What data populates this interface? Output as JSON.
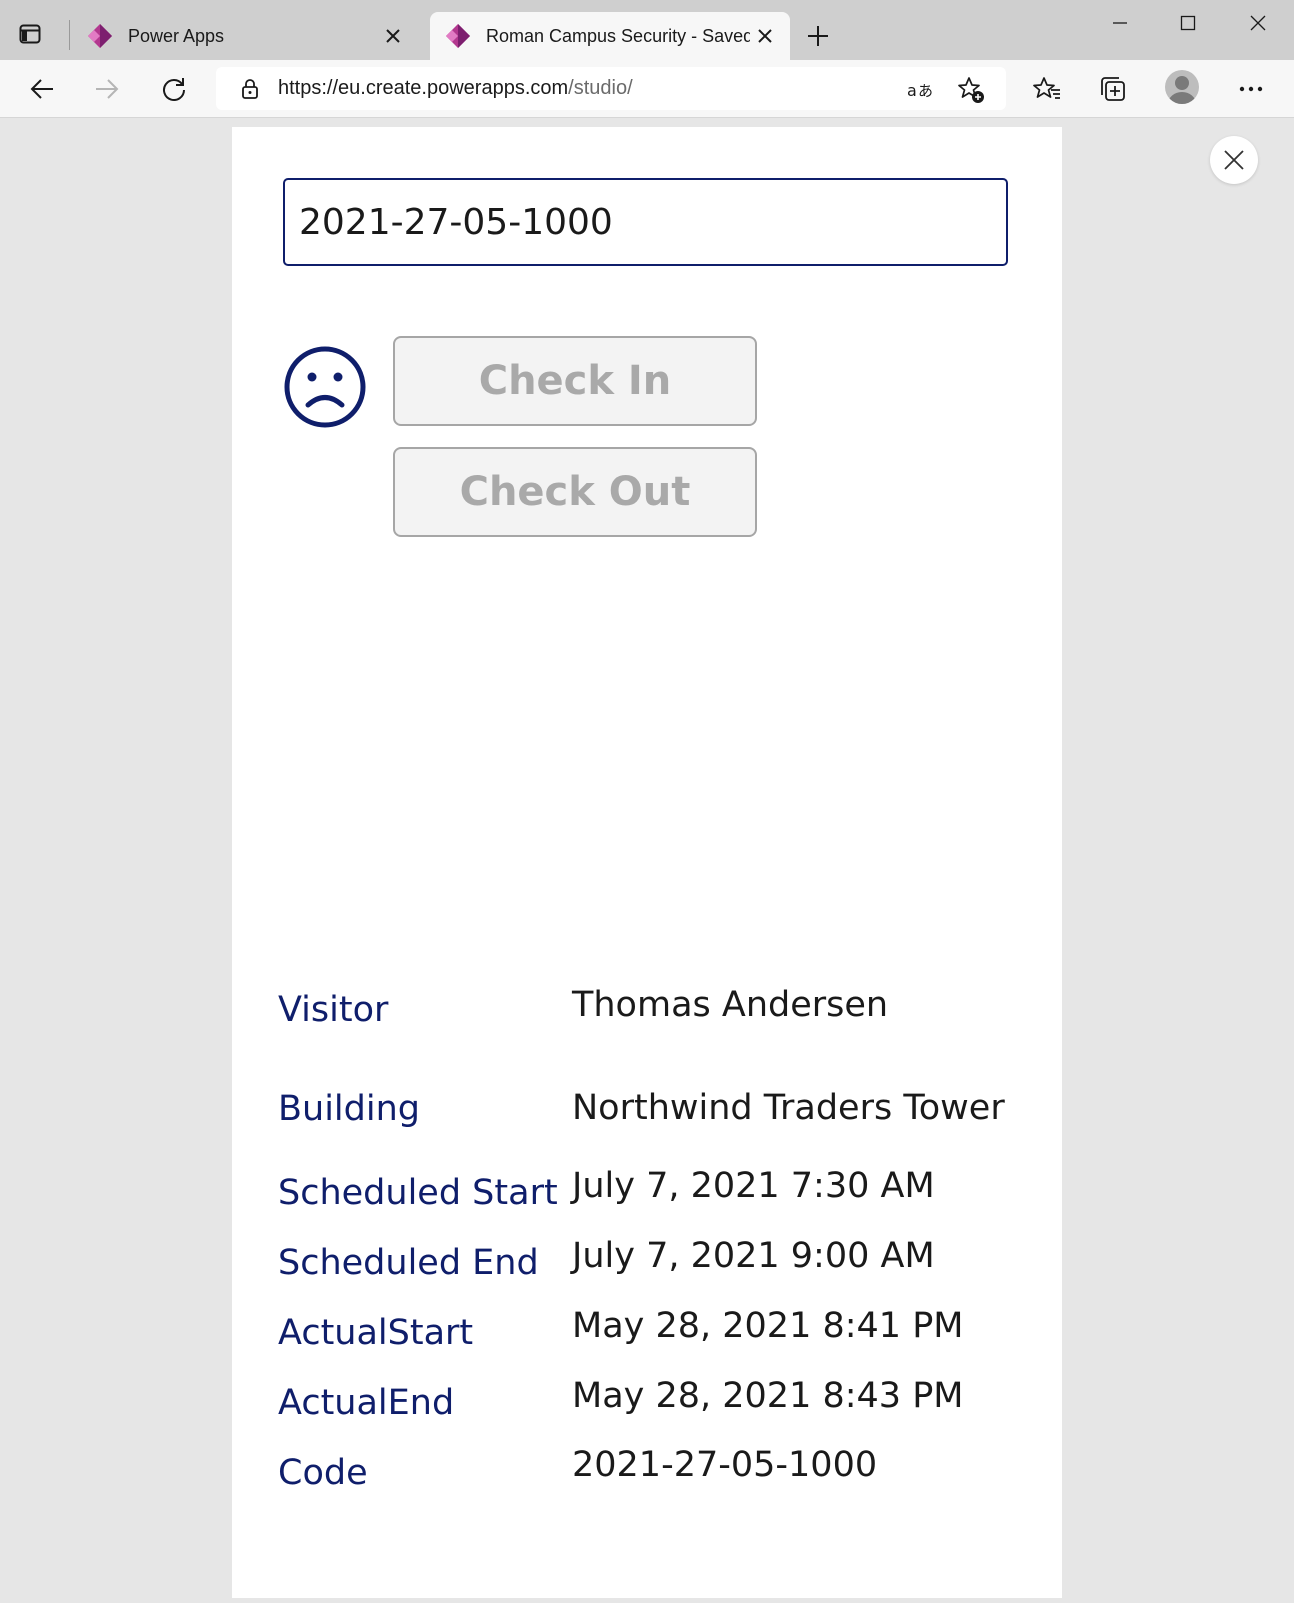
{
  "browser": {
    "tabs": [
      {
        "title": "Power Apps",
        "active": false,
        "icon": "power-apps-icon"
      },
      {
        "title": "Roman Campus Security - Saved",
        "active": true,
        "icon": "power-apps-icon"
      }
    ],
    "address": {
      "domain": "https://eu.create.powerapps.com",
      "path": "/studio/"
    },
    "icons": [
      "back-icon",
      "forward-icon",
      "refresh-icon",
      "lock-icon",
      "read-aloud-icon",
      "add-favorite-icon",
      "favorites-icon",
      "collections-icon",
      "profile-avatar",
      "more-icon",
      "tab-actions-icon",
      "new-tab-icon",
      "minimize-icon",
      "maximize-icon",
      "close-window-icon"
    ]
  },
  "app": {
    "code_input": {
      "value": "2021-27-05-1000"
    },
    "status_icon": "sad-face-icon",
    "check_in_label": "Check In",
    "check_out_label": "Check Out",
    "accent_color": "#0f1e6b",
    "fields": [
      {
        "label": "Visitor",
        "value": "Thomas Andersen"
      },
      {
        "label": "Building",
        "value": "Northwind Traders Tower"
      },
      {
        "label": "Scheduled Start",
        "value": "July 7, 2021 7:30 AM"
      },
      {
        "label": "Scheduled End",
        "value": "July 7, 2021 9:00 AM"
      },
      {
        "label": "ActualStart",
        "value": "May 28, 2021 8:41 PM"
      },
      {
        "label": "ActualEnd",
        "value": "May 28, 2021 8:43 PM"
      },
      {
        "label": "Code",
        "value": "2021-27-05-1000"
      }
    ]
  }
}
